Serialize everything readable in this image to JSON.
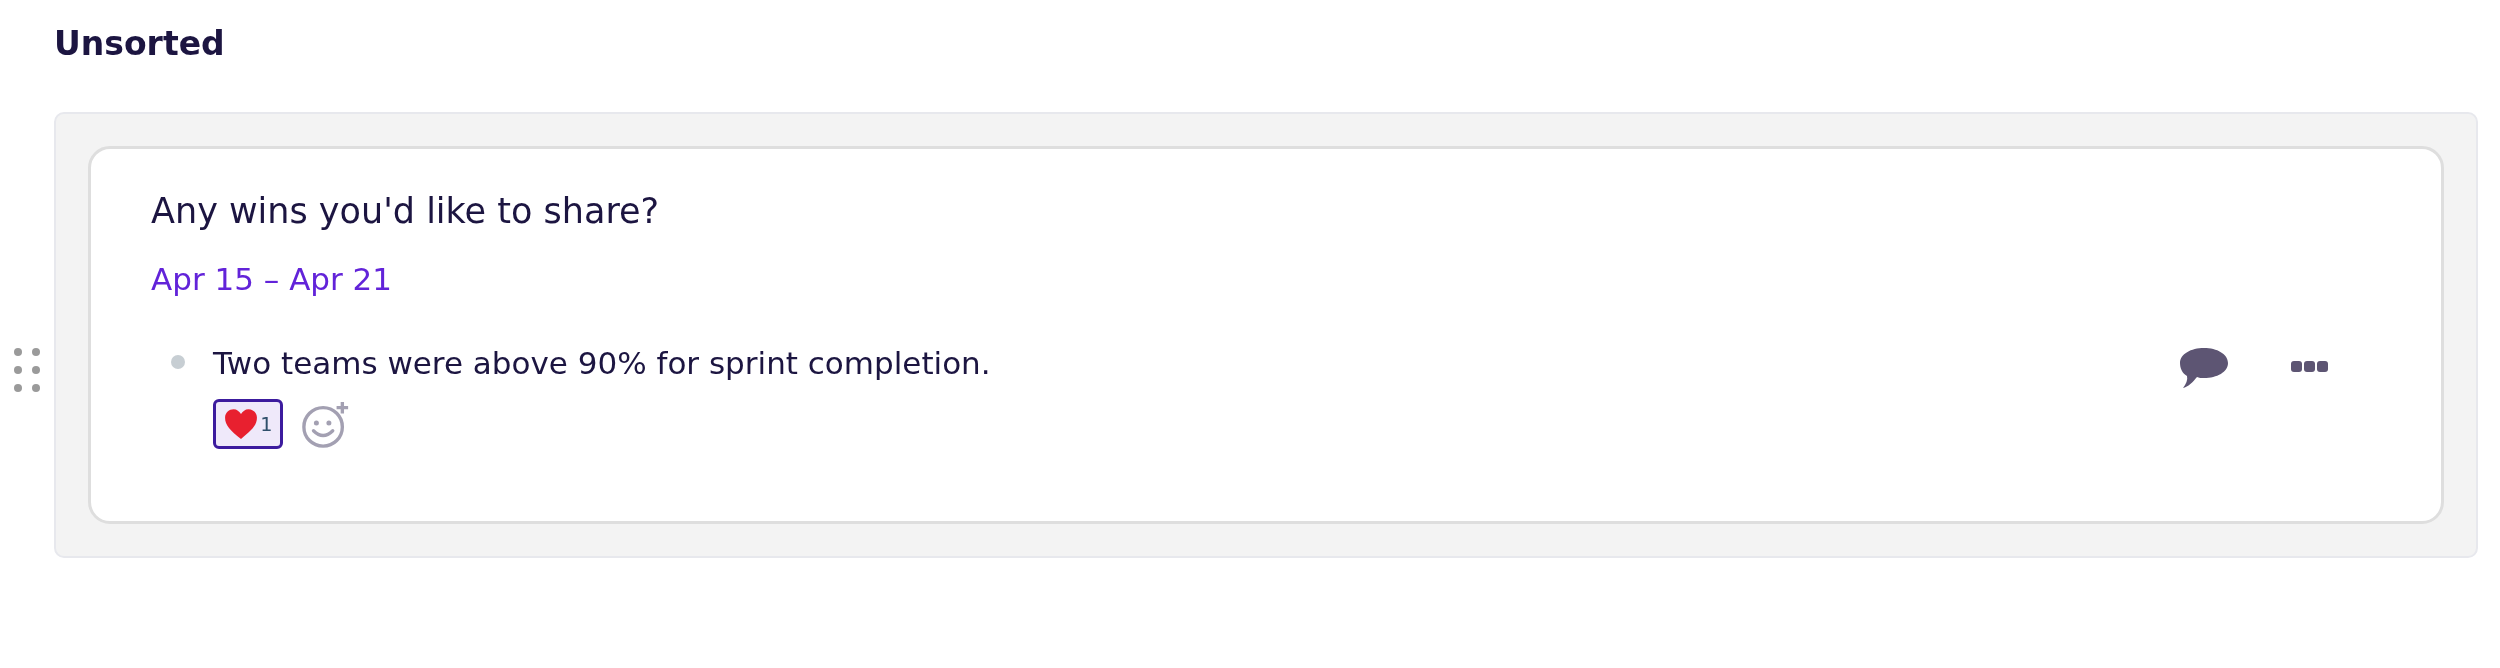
{
  "section": {
    "title": "Unsorted"
  },
  "card": {
    "question": "Any wins you'd like to share?",
    "date_range": "Apr 15 – Apr 21",
    "answers": [
      {
        "text": "Two teams were above 90% for sprint completion.",
        "reactions": [
          {
            "count": "1",
            "selected": true
          }
        ]
      }
    ]
  }
}
